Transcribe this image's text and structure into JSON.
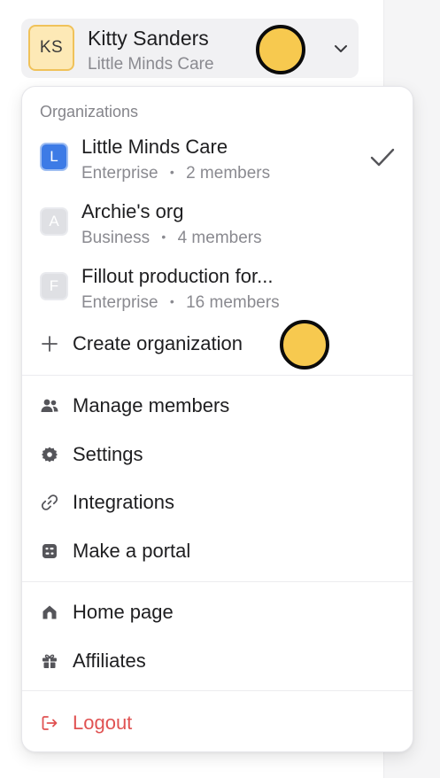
{
  "account": {
    "initials": "KS",
    "name": "Kitty Sanders",
    "organization": "Little Minds Care"
  },
  "dropdown": {
    "section_label": "Organizations",
    "organizations": [
      {
        "initial": "L",
        "name": "Little Minds Care",
        "plan": "Enterprise",
        "members": "2 members",
        "selected": true
      },
      {
        "initial": "A",
        "name": "Archie's org",
        "plan": "Business",
        "members": "4 members",
        "selected": false
      },
      {
        "initial": "F",
        "name": "Fillout production for...",
        "plan": "Enterprise",
        "members": "16 members",
        "selected": false
      }
    ],
    "separator": "•",
    "create_label": "Create organization",
    "menu": {
      "manage_members": "Manage members",
      "settings": "Settings",
      "integrations": "Integrations",
      "make_portal": "Make a portal",
      "home_page": "Home page",
      "affiliates": "Affiliates",
      "logout": "Logout"
    }
  },
  "colors": {
    "accent": "#3d7be6",
    "avatar_bg": "#fde9b6",
    "marker": "#f7c94f",
    "danger": "#e05252"
  }
}
